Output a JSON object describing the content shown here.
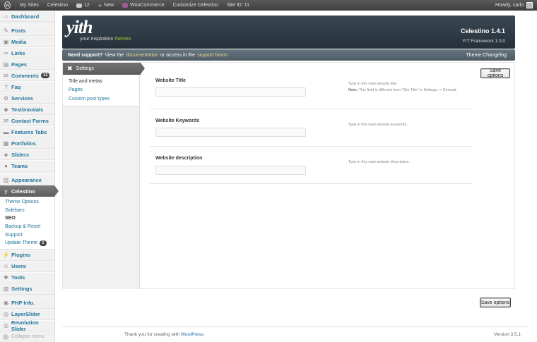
{
  "adminbar": {
    "logo": "W",
    "my_sites": "My Sites",
    "site_name": "Celestino",
    "comments_count": "12",
    "new_label": "New",
    "woocommerce": "WooCommerce",
    "customize": "Customize Celestino",
    "site_id": "Site ID: 11",
    "howdy": "Howdy, carlo"
  },
  "sidebar": {
    "items": [
      {
        "label": "Dashboard",
        "icon": "⌂"
      },
      {
        "label": "Posts",
        "icon": "✎"
      },
      {
        "label": "Media",
        "icon": "▣"
      },
      {
        "label": "Links",
        "icon": "∞"
      },
      {
        "label": "Pages",
        "icon": "▤"
      },
      {
        "label": "Comments",
        "icon": "✉",
        "badge": "12"
      },
      {
        "label": "Faq",
        "icon": "?"
      },
      {
        "label": "Services",
        "icon": "⚙"
      },
      {
        "label": "Testimonials",
        "icon": "☻"
      },
      {
        "label": "Contact Forms",
        "icon": "✉"
      },
      {
        "label": "Features Tabs",
        "icon": "▬"
      },
      {
        "label": "Portfolios",
        "icon": "▦"
      },
      {
        "label": "Sliders",
        "icon": "◈"
      },
      {
        "label": "Teams",
        "icon": "●"
      },
      {
        "label": "Appearance",
        "icon": "▥"
      },
      {
        "label": "Celestino",
        "icon": "y"
      },
      {
        "label": "Plugins",
        "icon": "⚡"
      },
      {
        "label": "Users",
        "icon": "☺"
      },
      {
        "label": "Tools",
        "icon": "✚"
      },
      {
        "label": "Settings",
        "icon": "▧"
      },
      {
        "label": "PHP Info.",
        "icon": "◉"
      },
      {
        "label": "LayerSlider",
        "icon": "◎"
      },
      {
        "label": "Revolution Slider",
        "icon": "◎"
      }
    ],
    "submenu": [
      {
        "label": "Theme Options"
      },
      {
        "label": "Sidebars"
      },
      {
        "label": "SEO"
      },
      {
        "label": "Backup & Reset"
      },
      {
        "label": "Support"
      },
      {
        "label": "Update Theme",
        "badge": "1"
      }
    ],
    "collapse": "Collapse menu"
  },
  "banner": {
    "logo": "yith",
    "tagline_prefix": "your inspiration",
    "tagline_highlight": "themes",
    "version": "Celestino 1.4.1",
    "framework": "YIT Framework 1.0.0"
  },
  "support": {
    "need": "Need support?",
    "view": "View the",
    "documentation": "documentation",
    "or": "or access in the",
    "forum": "support forum",
    "changelog": "Theme Changelog"
  },
  "tabs": {
    "header": "Settings",
    "items": [
      "Title and metas",
      "Pages",
      "Custom post types"
    ]
  },
  "save_label": "Save options",
  "fields": [
    {
      "label": "Website Title",
      "value": "",
      "desc": "Type in the main website title.",
      "note_label": "Note:",
      "note": "This field is different from \"Site Title\" in Settings -> General."
    },
    {
      "label": "Website Keywords",
      "value": "",
      "desc": "Type in the main website keywords."
    },
    {
      "label": "Website description",
      "value": "",
      "desc": "Type in the main website description."
    }
  ],
  "footer": {
    "thanks": "Thank you for creating with",
    "wordpress": "WordPress",
    "period": ".",
    "version": "Version 3.5.1"
  }
}
